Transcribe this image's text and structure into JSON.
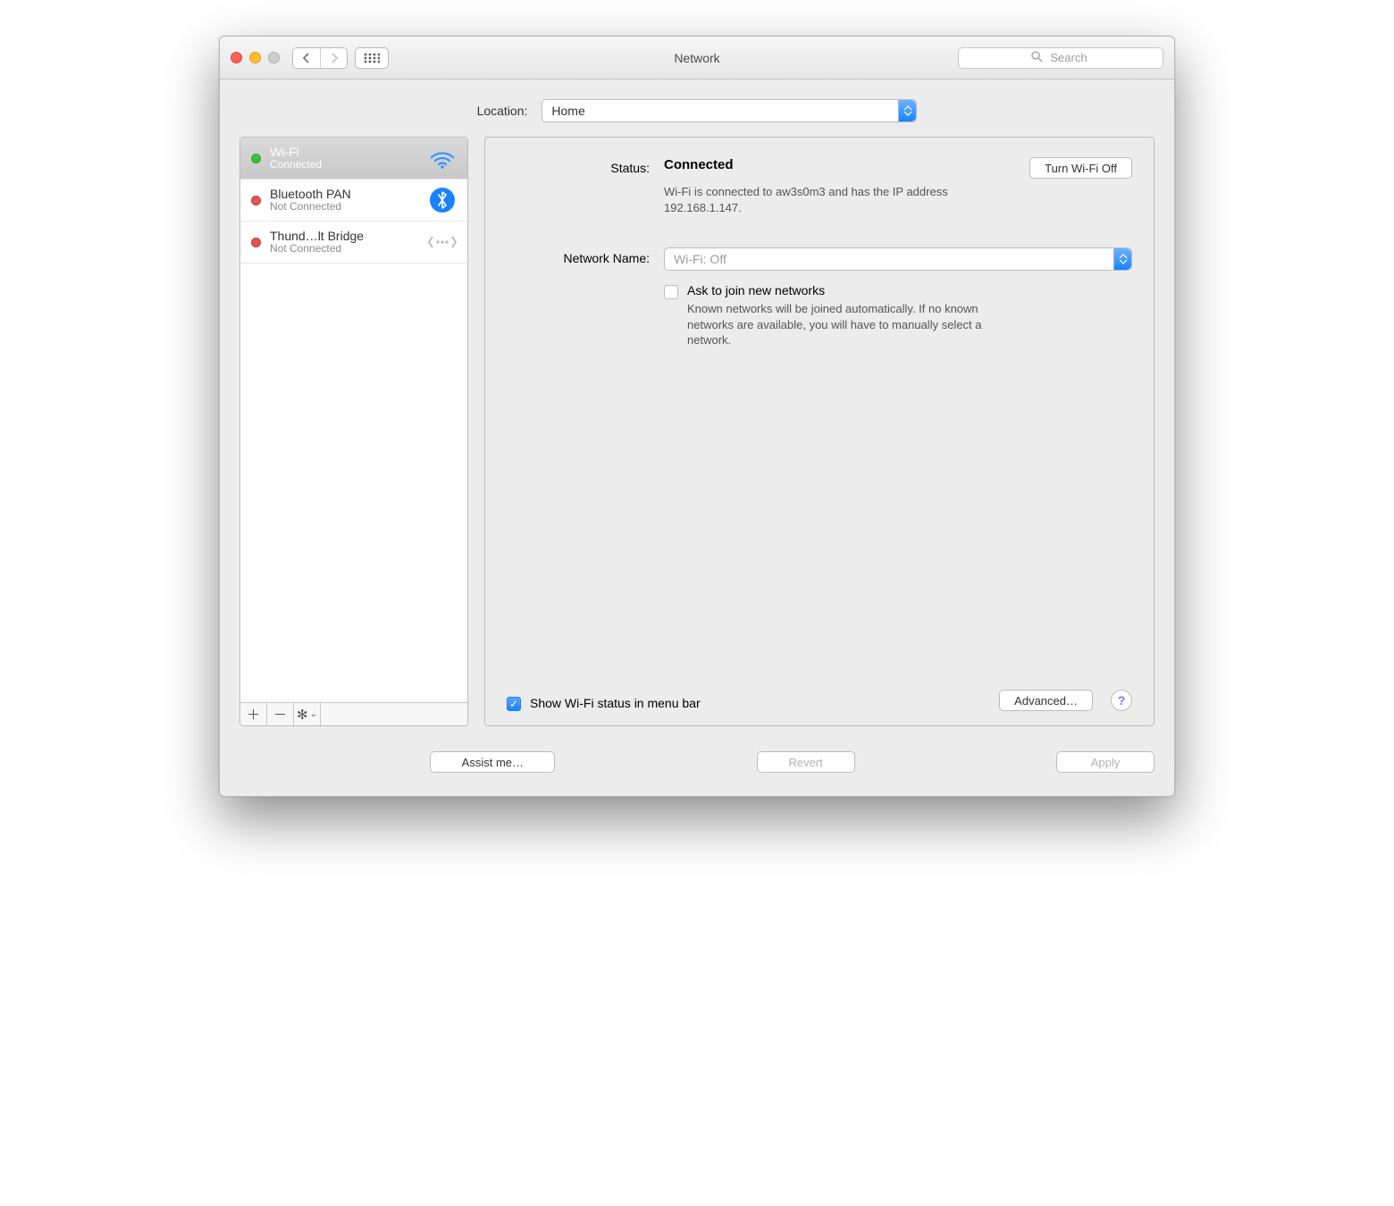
{
  "titlebar": {
    "title": "Network",
    "search_placeholder": "Search"
  },
  "location": {
    "label": "Location:",
    "value": "Home"
  },
  "services": [
    {
      "name": "Wi-Fi",
      "status": "Connected",
      "dot": "green",
      "icon": "wifi",
      "selected": true
    },
    {
      "name": "Bluetooth PAN",
      "status": "Not Connected",
      "dot": "red",
      "icon": "bluetooth",
      "selected": false
    },
    {
      "name": "Thund…lt Bridge",
      "status": "Not Connected",
      "dot": "red",
      "icon": "thunderbolt",
      "selected": false
    }
  ],
  "detail": {
    "status_label": "Status:",
    "status_value": "Connected",
    "toggle_button": "Turn Wi-Fi Off",
    "status_desc": "Wi-Fi is connected to aw3s0m3 and has the IP address 192.168.1.147.",
    "netname_label": "Network Name:",
    "netname_value": "Wi-Fi: Off",
    "ask_label": "Ask to join new networks",
    "ask_desc": "Known networks will be joined automatically. If no known networks are available, you will have to manually select a network.",
    "show_menubar": "Show Wi-Fi status in menu bar",
    "advanced": "Advanced…"
  },
  "bottom": {
    "assist": "Assist me…",
    "revert": "Revert",
    "apply": "Apply"
  }
}
